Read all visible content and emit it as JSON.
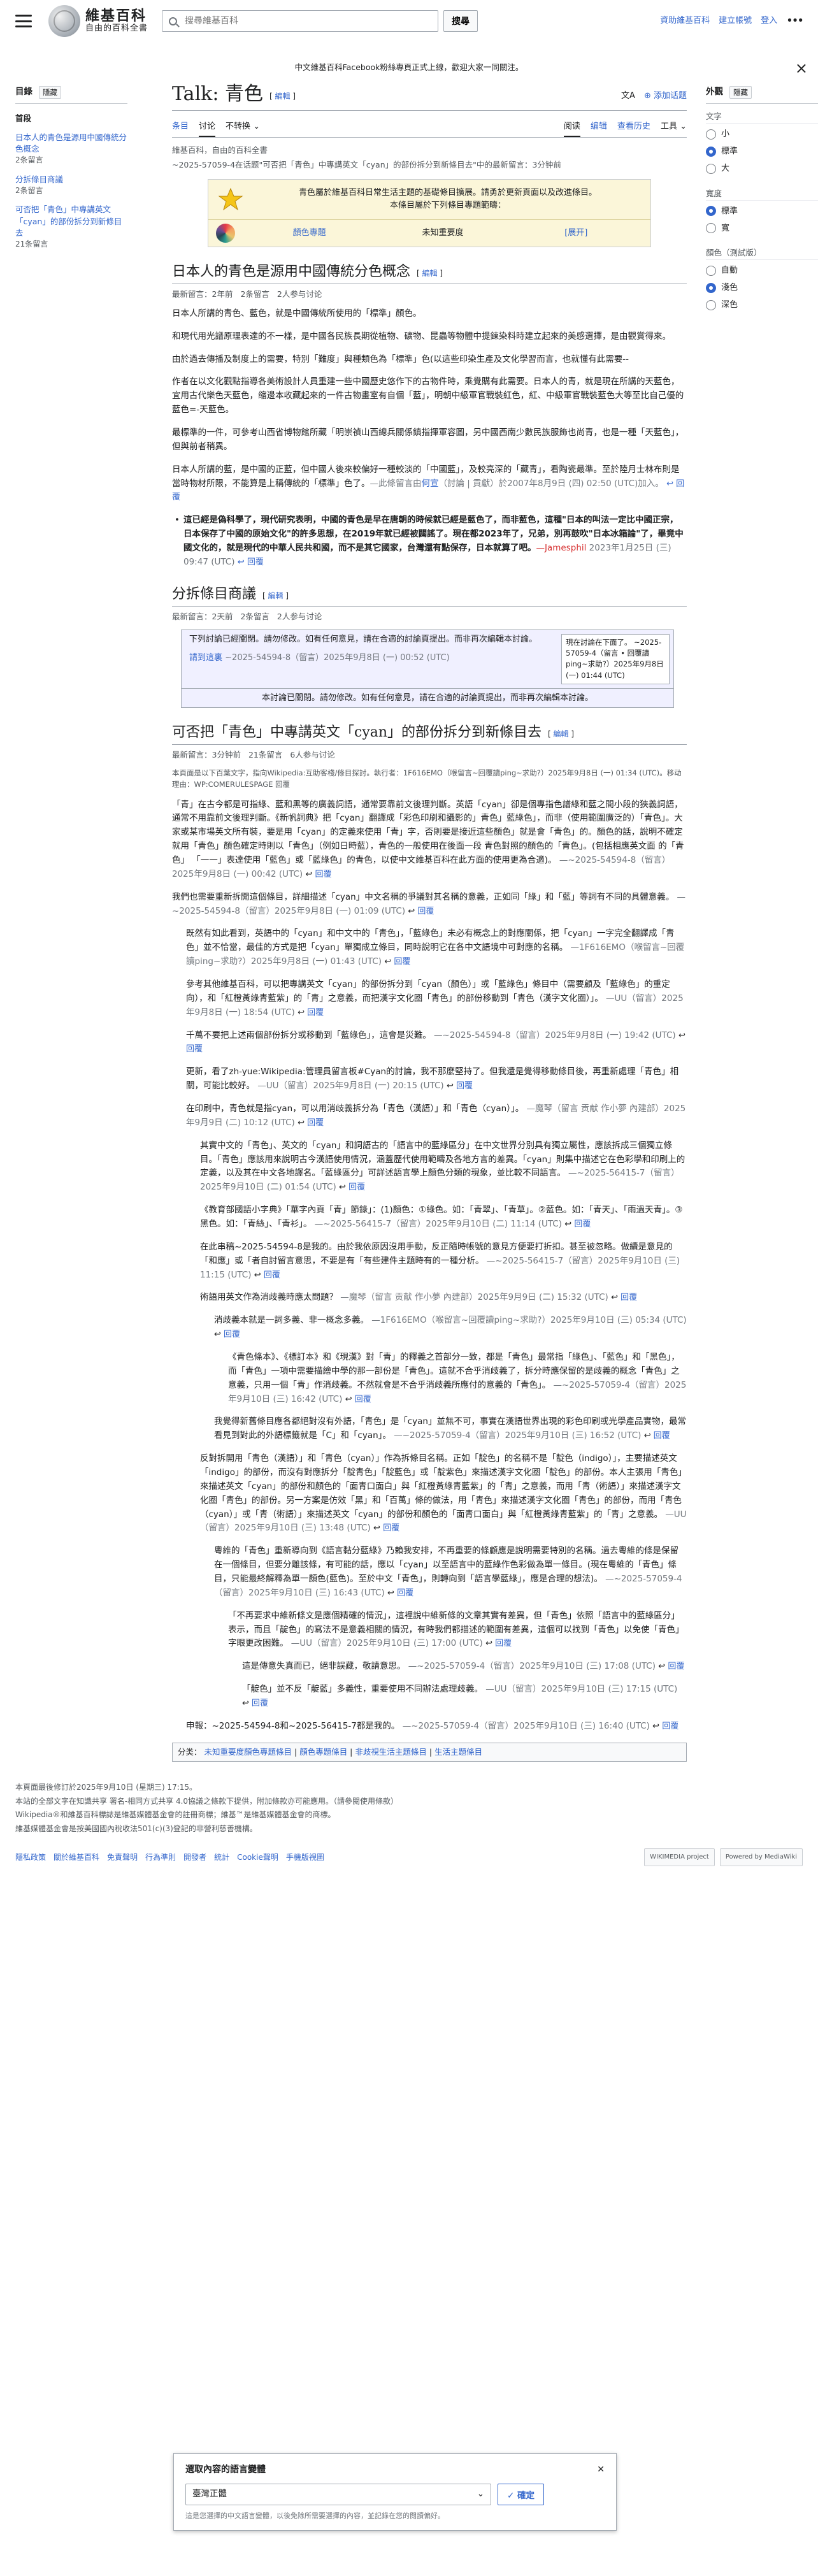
{
  "header": {
    "site_name": "維基百科",
    "site_tagline": "自由的百科全書",
    "search_placeholder": "搜尋維基百科",
    "search_button": "搜尋",
    "links": [
      "資助維基百科",
      "建立帳號",
      "登入"
    ]
  },
  "banner": {
    "text": "中文維基百科Facebook粉絲專頁正式上線，歡迎大家一同關注。"
  },
  "toc": {
    "title": "目錄",
    "hide": "隱藏",
    "items": [
      {
        "label": "首段",
        "sub": ""
      },
      {
        "label": "日本人的青色是源用中國傳統分色概念",
        "sub": "2条留言"
      },
      {
        "label": "分拆條目商議",
        "sub": "2条留言"
      },
      {
        "label": "可否把「青色」中專講英文「cyan」的部份拆分到新條目去",
        "sub": "21条留言"
      }
    ]
  },
  "page": {
    "title": "Talk: 青色",
    "edit": "編輯",
    "lang_icon": "文A",
    "add_topic": "添加话题",
    "tabs_left": [
      "条目",
      "讨论",
      "不转换"
    ],
    "tabs_right": [
      "阅读",
      "编辑",
      "查看历史",
      "工具"
    ],
    "tagline": "維基百科，自由的百科全書",
    "subline": "~2025-57059-4在话题\"可否把「青色」中專講英文「cyan」的部份拆分到新條目去\"中的最新留言：3分钟前"
  },
  "info_box": {
    "line1": "青色屬於維基百科日常生活主題的基礎條目擴展。請勇於更新頁面以及改進條目。",
    "line2": "本條目屬於下列條目專題範疇：",
    "project": "顏色專題",
    "importance": "未知重要度",
    "expand": "[展开]"
  },
  "sections": [
    {
      "title": "日本人的青色是源用中國傳統分色概念",
      "edit": "編輯",
      "meta": [
        "最新留言：2年前",
        "2条留言",
        "2人参与讨论"
      ]
    },
    {
      "title": "分拆條目商議",
      "edit": "編輯",
      "meta": [
        "最新留言：2天前",
        "2条留言",
        "2人参与讨论"
      ]
    },
    {
      "title": "可否把「青色」中專講英文「cyan」的部份拆分到新條目去",
      "edit": "編輯",
      "meta": [
        "最新留言：3分钟前",
        "21条留言",
        "6人参与讨论"
      ]
    }
  ],
  "s1": {
    "p1": "日本人所講的青色、藍色，就是中國傳統所使用的「標準」顏色。",
    "p2": "和現代用光譜原理表達的不一樣，是中國各民族長期從植物、礦物、昆蟲等物體中提鍊染料時建立起來的美感選擇，是由觀賞得來。",
    "p3": "由於過去傳播及制度上的需要，特別「難度」與種類色為「標準」色(以這些印染生產及文化學習而言，也就懂有此需要--",
    "p4": "作者在以文化觀點指導各美術設計人員重建一些中國歷史悠作下的古物件時，乘覺購有此需要。日本人的青，就是現在所講的天藍色，宜用古代樂色天藍色，缩邊本收藏起來的一件古物畫室有自個「藍」，明朝中級軍官戰裝紅色，紅、中級軍官戰裝藍色大等至比自己優的藍色=-天藍色。",
    "p5": "最標準的一件，可參考山西省博物館所藏「明崇禎山西總兵關係鎮指揮軍容圖，另中國西南少數民族服飾也尚青，也是一種「天藍色」，但與前者稍異。",
    "p6": "日本人所講的藍，是中國的正藍，但中國人後來較偏好一種較淡的「中國藍」，及較亮深的「藏青」，看陶瓷最準。至於陸月士林布則是當時物材所限，不能算是上稱傳統的「標準」色了。",
    "sig1": "—此條留言由",
    "sig1_link": "何宣",
    "sig1_rest": "（討論 | 貢獻）於2007年8月9日 (四) 02:50 (UTC)加入。",
    "reply": "回覆",
    "bullet": "這已經是偽科學了，現代研究表明，中國的青色是早在唐朝的時候就已經是藍色了，而非藍色，這種\"日本的叫法一定比中國正宗，日本保存了中國的原始文化\"的許多思想，在2019年就已經被闢謠了。現在都2023年了，兄弟，別再鼓吹\"日本冰箱論\"了，畢竟中國文化的，就是現代的中華人民共和國，而不是其它國家，台灣還有點保存，日本就算了吧。",
    "bullet_sig": "—Jamesphil",
    "bullet_time": "2023年1月25日 (三) 09:47 (UTC)"
  },
  "s2": {
    "merge_main": "下列討論已經關閉。請勿修改。如有任何意見，請在合適的討論頁提出。而非再次編輯本討論。",
    "merge_link": "請到這裏",
    "merge_sig": "~2025-54594-8（留言）2025年9月8日 (一) 00:52 (UTC)",
    "merge_side": "現在討論在下面了。 ~2025-57059-4（留言 • 回覆讀ping~求助?）2025年9月8日 (一) 01:44 (UTC)",
    "merge_foot": "本討論已關閉。請勿修改。如有任何意見，請在合適的討論頁提出，而非再次編輯本討論。"
  },
  "s3": {
    "notice": "本頁面是以下百葉文字，指向Wikipedia:互助客棧/條目探討。執行者：1F616EMO（喉留言~回覆讀ping~求助?）2025年9月8日 (一) 01:34 (UTC)。移动理由：WP:COMERULESPAGE 回覆",
    "p1": "「青」在古今都是可指綠、藍和黑等的廣義詞語，通常要靠前文後理判斷。英語「cyan」卻是個專指色譜綠和藍之間小段的狹義詞語，通常不用靠前文後理判斷。《新帆詞典》把「cyan」翻譯成「彩色印刷和攝影的」青色」藍綠色」，而非（使用範圍廣泛的）「青色」。大家或某市場英文所有裝，要是用「cyan」的定義來使用「青」字，否則要是接近這些顏色」就是會「青色」的。顏色的話，說明不確定就用「青色」顏色確定時則以「青色」（例如日時藍），青色的一般使用在後面一段 青色對照的顏色的「青色」。(包括相應英文面 的「青色」 「一一」表達使用「藍色」或「藍綠色」的青色，以使中文維基百科在此方面的使用更為合適)。",
    "sig_a": "—~2025-54594-8（留言）2025年9月8日 (一) 00:42 (UTC)",
    "p2": "我們也需要重新拆開這個條目，詳細描述「cyan」中文名稱的爭議對其名稱的意義，正如同「綠」和「藍」等詞有不同的具體意義。",
    "sig_b": "—~2025-54594-8（留言）2025年9月8日 (一) 01:09 (UTC)",
    "p3": "既然有如此看到，英語中的「cyan」和中文中的「青色」，「藍綠色」未必有概念上的對應關係，把「cyan」一字完全翻譯成「青色」並不恰當，最佳的方式是把「cyan」單獨成立條目，同時說明它在各中文語境中可對應的名稱。",
    "sig_c": "—1F616EMO（喉留言~回覆讀ping~求助?）2025年9月8日 (一) 01:43 (UTC)",
    "p4": "參考其他維基百科，可以把專講英文「cyan」的部份拆分到「cyan（顏色）」或「藍綠色」條目中（需要顧及「藍綠色」的重定向），和「紅橙黃綠青藍紫」的「青」之意義，而把漢字文化圈「青色」的部份移動到「青色（漢字文化圈）」。",
    "sig_d": "—UU（留言）2025年9月8日 (一) 18:54 (UTC)",
    "p5": "千萬不要把上述兩個部份拆分或移動到「藍綠色」，這會是災難。",
    "sig_e": "—~2025-54594-8（留言）2025年9月8日 (一) 19:42 (UTC)",
    "p6": "更新，看了zh-yue:Wikipedia:管理員留言板#Cyan的討論，我不那麼堅持了。但我還是覺得移動條目後，再重新處理「青色」相關，可能比較好。",
    "sig_f": "—UU（留言）2025年9月8日 (一) 20:15 (UTC)",
    "p7": "在印刷中，青色就是指cyan，可以用消歧義拆分為「青色（漢語）」和「青色（cyan）」。",
    "sig_g": "—魔琴（留言 贡献 作小夢 內建部）2025年9月9日 (二) 10:12 (UTC)",
    "p8": "其實中文的「青色」、英文的「cyan」和詞語古的「語言中的藍綠區分」在中文世界分別具有獨立屬性，應該拆成三個獨立條目。「青色」應該用來說明古今漢語使用情況，涵蓋歷代使用範疇及各地方言的差異。「cyan」則集中描述它在色彩學和印刷上的定義，以及其在中文各地譯名。「藍綠區分」可詳述語言學上顏色分類的現象，並比較不同語言。",
    "sig_h": "—~2025-56415-7（留言）2025年9月10日 (二) 01:54 (UTC)",
    "p9": "《教育部國語小字典》「華字內頁「青」節錄」：(1)顏色：①綠色。如：「青翠」、「青草」。②藍色。如：「青天」、「雨過天青」。③黑色。如：「青絲」、「青衫」。",
    "sig_i": "—~2025-56415-7（留言）2025年9月10日 (二) 11:14 (UTC)",
    "p10": "在此串稿~2025-54594-8是我的。由於我依原因沒用手動，反正隨時帳號的意見方便要打折扣。甚至被忽略。做續是意見的「和應」或「者自討留言意思，不要是有「有些建件主題時有的一種分析。",
    "sig_j": "—~2025-56415-7（留言）2025年9月10日 (三) 11:15 (UTC)",
    "p11": "術語用英文作為消歧義時應太問題？",
    "sig_k": "—魔琴（留言 贡献 作小夢 內建部）2025年9月9日 (二) 15:32 (UTC)",
    "p12": "消歧義本就是一詞多義、非一概念多義。",
    "sig_l": "—1F616EMO（喉留言~回覆讀ping~求助?）2025年9月10日 (三) 05:34 (UTC)",
    "p13": "《青色條本》、《標訂本》和《現漢》對「青」的釋義之首部分一致，都是「青色」最常指「綠色」、「藍色」和「黑色」，而「青色」一項中需要描繪中學的那一部份是「青色」。這就不合乎消歧義了，拆分時應保留的是歧義的概念「青色」之意義，只用一個「青」作消歧義。不然就會是不合乎消歧義所應付的意義的「青色」。",
    "sig_m": "—~2025-57059-4（留言）2025年9月10日 (三) 16:42 (UTC)",
    "p14": "我覺得新舊條目應各都絕對沒有外語，「青色」是「cyan」並無不可，事實在漢語世界出現的彩色印刷或光學產品實物，最常看見到對此的外語標籤就是「C」和「cyan」。",
    "sig_n": "—~2025-57059-4（留言）2025年9月10日 (三) 16:52 (UTC)",
    "p15": "反對拆開用「青色（漢語）」和「青色（cyan）」作為拆條目名稱。正如「靛色」的名稱不是「靛色（indigo）」，主要描述英文「indigo」的部份，而沒有對應拆分「靛青色」「靛藍色」或「靛紫色」來描述漢字文化圈「靛色」的部份。本人主張用「青色」來描述英文「cyan」的部份和顏色的「面青口面白」與「紅橙黃綠青藍紫」的「青」之意義，而用「青（術語）」來描述漢字文化圈「青色」的部份。另一方案是仿效「黑」和「百萬」條的做法，用「青色」來描述漢字文化圈「青色」的部份，而用「青色（cyan）」或「青（術語）」來描述英文「cyan」的部份和顏色的「面青口面白」與「紅橙黃綠青藍紫」的「青」之意義。",
    "sig_o": "—UU（留言）2025年9月10日 (三) 13:48 (UTC)",
    "p16": "粵維的「青色」重新導向到《語言黏分藍綠》乃賴我安排，不再重要的條顧應是說明需要特別的名稱。過去粵維的條是保留在一個條目，但要分離該條，有可能的話，應以「cyan」以至語言中的藍綠作色彩做為單一條目。(現在粵維的「青色」條目，只能最終解釋為單一顏色(藍色)。至於中文「青色」，則轉向到「語言學藍綠」，應是合理的想法)。",
    "sig_p": "—~2025-57059-4（留言）2025年9月10日 (三) 16:43 (UTC)",
    "p17": "「不再要求中維新條文是應個精確的情況」，這裡說中維新條的文章其實有差異，但「青色」依照「語言中的藍綠區分」表示，而且「靛色」的寫法不是意義相關的情況，有時我們都描述的範圍有差異，這個可以找到「青色」以免使「青色」字眼更改困難。",
    "sig_q": "—UU（留言）2025年9月10日 (三) 17:00 (UTC)",
    "p18": "這是傳意失真而已，絕非誤藏，敬請意思。",
    "sig_r": "—~2025-57059-4（留言）2025年9月10日 (三) 17:08 (UTC)",
    "p19": "「靛色」並不反「靛藍」多義性，重要使用不同辦法處理歧義。",
    "sig_s": "—UU（留言）2025年9月10日 (三) 17:15 (UTC)",
    "p20": "申報：~2025-54594-8和~2025-56415-7都是我的。",
    "sig_t": "—~2025-57059-4（留言）2025年9月10日 (三) 16:40 (UTC)"
  },
  "categories": {
    "label": "分类：",
    "items": [
      "未知重要度顏色專題條目",
      "顏色專題條目",
      "非歧視生活主題條目",
      "生活主題條目"
    ]
  },
  "dialog": {
    "title": "選取內容的語言變體",
    "value": "臺灣正體",
    "button": "確定",
    "note": "這是您選擇的中文語言變體，以後免除所需要選擇的內容，並記錄在您的閱讀偏好。"
  },
  "footer": {
    "line1": "本頁面最後修訂於2025年9月10日 (星期三) 17:15。",
    "line2": "本站的全部文字在知識共享 署名-相同方式共享 4.0協議之條款下提供，附加條款亦可能應用。（請參閱使用條款）",
    "line3": "Wikipedia®和維基百科標誌是維基媒體基金會的註冊商標；維基™是維基媒體基金會的商標。",
    "line4": "維基媒體基金會是按美國國內稅收法501(c)(3)登記的非營利慈善機構。",
    "links": [
      "隱私政策",
      "關於維基百科",
      "免責聲明",
      "行為準則",
      "開發者",
      "統計",
      "Cookie聲明",
      "手機版視圖"
    ],
    "badges": [
      "WIKIMEDIA project",
      "Powered by MediaWiki"
    ]
  },
  "right": {
    "appearance": "外觀",
    "hide": "隱藏",
    "text_group": "文字",
    "text_options": [
      "小",
      "標準",
      "大"
    ],
    "width_group": "寬度",
    "width_options": [
      "標準",
      "寬"
    ],
    "color_group": "顏色（測試版）",
    "color_options": [
      "自動",
      "淺色",
      "深色"
    ]
  }
}
